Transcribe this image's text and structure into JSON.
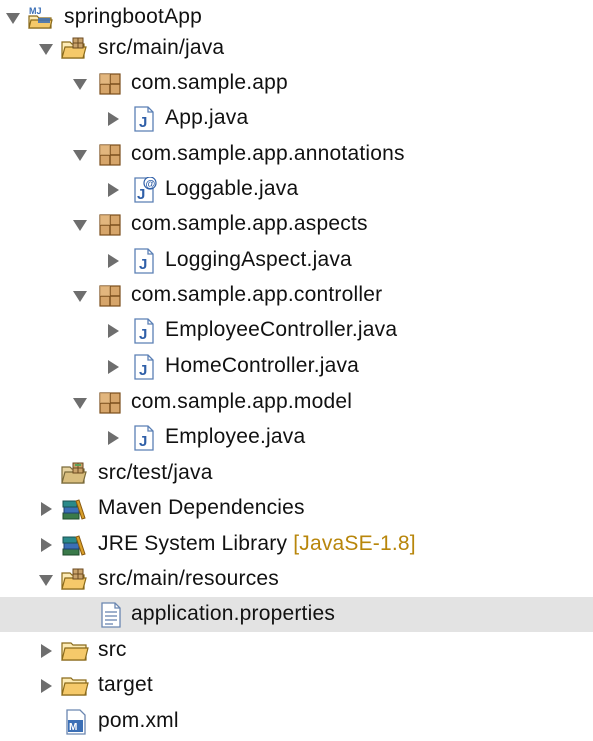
{
  "project_tree": {
    "items": [
      {
        "label": "springbootApp",
        "icon": "maven-project-icon",
        "toggle": "expanded"
      },
      {
        "label": "src/main/java",
        "icon": "source-folder-icon",
        "toggle": "expanded"
      },
      {
        "label": "com.sample.app",
        "icon": "package-icon",
        "toggle": "expanded"
      },
      {
        "label": "App.java",
        "icon": "java-file-icon",
        "toggle": "collapsed"
      },
      {
        "label": "com.sample.app.annotations",
        "icon": "package-icon",
        "toggle": "expanded"
      },
      {
        "label": "Loggable.java",
        "icon": "java-annotation-file-icon",
        "toggle": "collapsed"
      },
      {
        "label": "com.sample.app.aspects",
        "icon": "package-icon",
        "toggle": "expanded"
      },
      {
        "label": "LoggingAspect.java",
        "icon": "java-file-icon",
        "toggle": "collapsed"
      },
      {
        "label": "com.sample.app.controller",
        "icon": "package-icon",
        "toggle": "expanded"
      },
      {
        "label": "EmployeeController.java",
        "icon": "java-file-icon",
        "toggle": "collapsed"
      },
      {
        "label": "HomeController.java",
        "icon": "java-file-icon",
        "toggle": "collapsed"
      },
      {
        "label": "com.sample.app.model",
        "icon": "package-icon",
        "toggle": "expanded"
      },
      {
        "label": "Employee.java",
        "icon": "java-file-icon",
        "toggle": "collapsed"
      },
      {
        "label": "src/test/java",
        "icon": "source-folder-icon",
        "toggle": "none"
      },
      {
        "label": "Maven Dependencies",
        "icon": "library-icon",
        "toggle": "collapsed"
      },
      {
        "label": "JRE System Library",
        "decoration": "[JavaSE-1.8]",
        "icon": "library-icon",
        "toggle": "collapsed"
      },
      {
        "label": "src/main/resources",
        "icon": "source-folder-icon",
        "toggle": "expanded"
      },
      {
        "label": "application.properties",
        "icon": "properties-file-icon",
        "toggle": "none",
        "selected": true
      },
      {
        "label": "src",
        "icon": "folder-icon",
        "toggle": "collapsed"
      },
      {
        "label": "target",
        "icon": "folder-icon",
        "toggle": "collapsed"
      },
      {
        "label": "pom.xml",
        "icon": "maven-pom-file-icon",
        "toggle": "none"
      }
    ]
  },
  "colors": {
    "selection_background": "#e3e3e3",
    "decoration_text": "#b8860b",
    "toggle_arrow": "#6e6e6e"
  }
}
